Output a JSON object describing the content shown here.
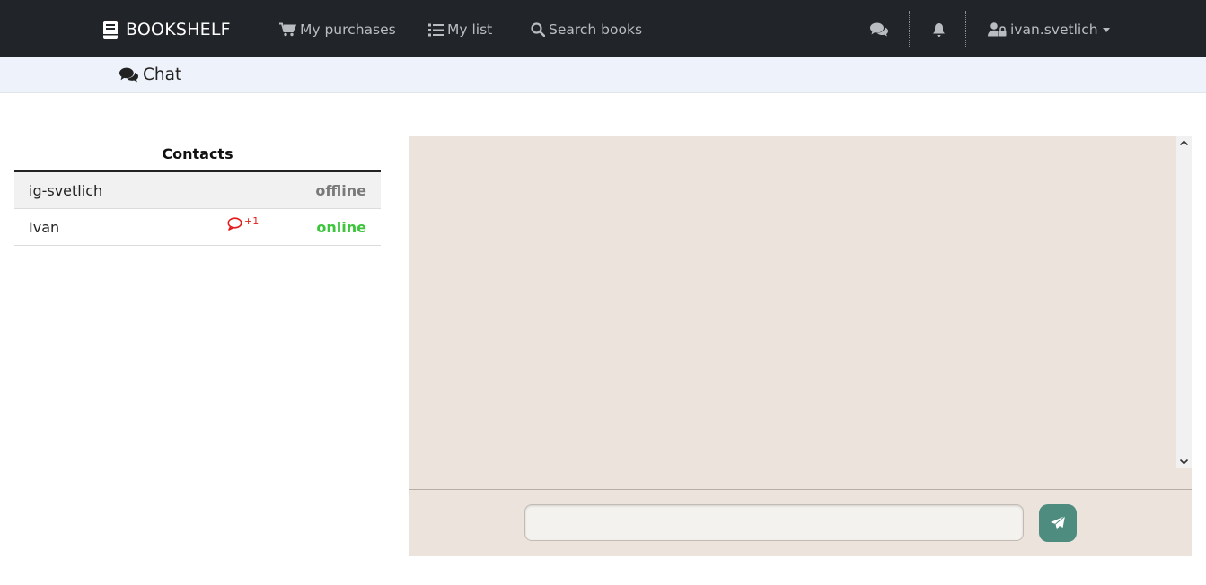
{
  "navbar": {
    "brand": "BOOKSHELF",
    "links": [
      {
        "label": "My purchases",
        "icon": "cart-icon"
      },
      {
        "label": "My list",
        "icon": "list-icon"
      },
      {
        "label": "Search books",
        "icon": "search-icon"
      }
    ],
    "chat_icon": "comments-icon",
    "bell_icon": "bell-icon",
    "user": {
      "name": "ivan.svetlich",
      "icon": "user-lock-icon"
    }
  },
  "subheader": {
    "title": "Chat",
    "icon": "comments-icon"
  },
  "contacts": {
    "title": "Contacts",
    "items": [
      {
        "name": "ig-svetlich",
        "status": "offline",
        "unread": ""
      },
      {
        "name": "Ivan",
        "status": "online",
        "unread": "+1"
      }
    ]
  },
  "chat": {
    "input_value": "",
    "input_placeholder": "",
    "send_icon": "paper-plane-icon"
  },
  "colors": {
    "navbar_bg": "#212529",
    "subheader_bg": "#eef2fa",
    "chat_bg": "#ece4dc",
    "online": "#3ec53e",
    "offline": "#7a7a7a",
    "unread": "#e31b1b",
    "send_button": "#4d8c7f"
  }
}
